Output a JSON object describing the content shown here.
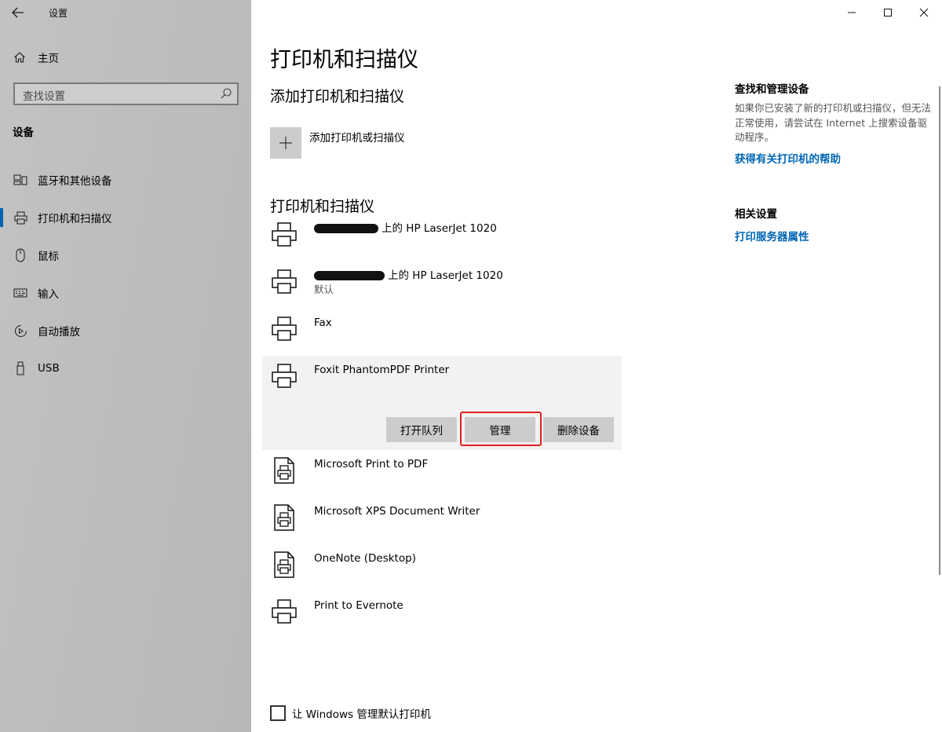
{
  "app": {
    "title": "设置",
    "back_label": "←"
  },
  "window_controls": {
    "minimize": "—",
    "maximize": "☐",
    "close": "✕"
  },
  "sidebar": {
    "home_label": "主页",
    "search_placeholder": "查找设置",
    "section_label": "设备",
    "items": [
      {
        "label": "蓝牙和其他设备",
        "icon": "bluetooth-devices-icon",
        "selected": false
      },
      {
        "label": "打印机和扫描仪",
        "icon": "printer-icon",
        "selected": true
      },
      {
        "label": "鼠标",
        "icon": "mouse-icon",
        "selected": false
      },
      {
        "label": "输入",
        "icon": "keyboard-icon",
        "selected": false
      },
      {
        "label": "自动播放",
        "icon": "autoplay-icon",
        "selected": false
      },
      {
        "label": "USB",
        "icon": "usb-icon",
        "selected": false
      }
    ]
  },
  "main": {
    "page_title": "打印机和扫描仪",
    "add_section_title": "添加打印机和扫描仪",
    "add_button_label": "添加打印机或扫描仪",
    "list_section_title": "打印机和扫描仪",
    "devices": [
      {
        "name": "上的 HP LaserJet 1020",
        "status": "",
        "icon": "printer-icon",
        "redacted": true
      },
      {
        "name": "上的 HP LaserJet 1020",
        "status": "默认",
        "icon": "printer-icon",
        "redacted": true
      },
      {
        "name": "Fax",
        "status": "",
        "icon": "printer-icon",
        "redacted": false
      },
      {
        "name": "Foxit PhantomPDF Printer",
        "status": "",
        "icon": "printer-icon",
        "redacted": false,
        "expanded": true
      },
      {
        "name": "Microsoft Print to PDF",
        "status": "",
        "icon": "document-printer-icon",
        "redacted": false
      },
      {
        "name": "Microsoft XPS Document Writer",
        "status": "",
        "icon": "document-printer-icon",
        "redacted": false
      },
      {
        "name": "OneNote (Desktop)",
        "status": "",
        "icon": "document-printer-icon",
        "redacted": false
      },
      {
        "name": "Print to Evernote",
        "status": "",
        "icon": "printer-icon",
        "redacted": false
      }
    ],
    "expanded_actions": {
      "open_queue": "打开队列",
      "manage": "管理",
      "remove": "删除设备"
    },
    "default_checkbox_label": "让 Windows 管理默认打印机"
  },
  "related": {
    "find_title": "查找和管理设备",
    "find_text": "如果你已安装了新的打印机或扫描仪，但无法正常使用，请尝试在 Internet 上搜索设备驱动程序。",
    "help_link": "获得有关打印机的帮助",
    "related_title": "相关设置",
    "server_link": "打印服务器属性"
  },
  "colors": {
    "accent": "#0063b1",
    "link": "#0066b4",
    "highlight": "#e02020",
    "sidebar_bg": "#bebebe",
    "button_bg": "#cccccc"
  }
}
